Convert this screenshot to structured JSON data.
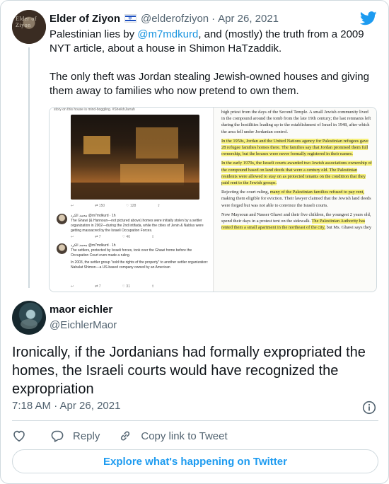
{
  "quoted_tweet": {
    "name": "Elder of Ziyon",
    "flag_icon": "israel-flag-icon",
    "handle": "@elderofziyon",
    "separator": "·",
    "date": "Apr 26, 2021",
    "avatar_text": "Elder of Ziyon",
    "text_prefix": "Palestinian lies by ",
    "mention": "@m7mdkurd",
    "text_suffix": ",  and (mostly)  the truth from a 2009 NYT article, about a house in Shimon HaTzaddik.",
    "paragraph2": "The only theft was Jordan stealing Jewish-owned houses and giving them away to families who now pretend to own them."
  },
  "media": {
    "left_top_caption": "story on this house is mind-boggling. #SheikhJarrah",
    "photo_actions": [
      "↩",
      "⇄ 150",
      "♡ 128",
      "⇪"
    ],
    "embedded_tweets": [
      {
        "header": "محمد الكرد @m7mdkurd · 1h",
        "body": "The Ghawi (& Hannoun—not pictured above) homes were initially stolen by a settler organization in 2002—during the 2nd intifada, while the cities of Jenin & Nablus were getting massacred by the Israeli Occupation Forces.",
        "actions": [
          "↩",
          "⇄ 7",
          "♡ 46",
          "⇪"
        ]
      },
      {
        "header": "محمد الكرد @m7mdkurd · 1h",
        "body": "The settlers, protected by Israeli forces, took over the Ghawi home before the Occupation Court even made a ruling.",
        "body2": "In 2003, the settler group \"sold the rights of the property\" to another settler organization: Nahalat Shimon—a US-based company owned by an American",
        "actions": [
          "↩",
          "⇄ 7",
          "♡ 31",
          "⇪"
        ]
      }
    ],
    "article_paragraphs": [
      {
        "text": "high priest from the days of the Second Temple. A small Jewish community lived in the compound around the tomb from the late 19th century; the last remnants left during the hostilities leading up to the establishment of Israel in 1948, after which the area fell under Jordanian control.",
        "hl": ""
      },
      {
        "text": "",
        "hl": "In the 1950s, Jordan and the United Nations agency for Palestinian refugees gave 28 refugee families homes there. The families say that Jordan promised them full ownership, but the houses were never formally registered in their names."
      },
      {
        "text": "",
        "hl": "In the early 1970s, the Israeli courts awarded two Jewish associations ownership of the compound based on land deeds that were a century old. The Palestinian residents were allowed to stay on as protected tenants on the condition that they paid rent to the Jewish groups."
      },
      {
        "text": "Rejecting the court ruling, ",
        "hl": "many of the Palestinian families refused to pay rent,",
        "text2": " making them eligible for eviction. Their lawyer claimed that the Jewish land deeds were forged but was not able to convince the Israeli courts."
      },
      {
        "text": "Now Maysoun and Nasser Ghawi and their five children, the youngest 2 years old, spend their days in a protest tent on the sidewalk. ",
        "hl": "The Palestinian Authority has rented them a small apartment in the northeast of the city,",
        "text2": " but Ms. Ghawi says they"
      }
    ]
  },
  "reply_tweet": {
    "name": "maor eichler",
    "handle": "@EichlerMaor",
    "text": "Ironically, if the Jordanians had formally expropriated the homes, the Israeli courts would have recognized the expropriation",
    "time": "7:18 AM · Apr 26, 2021"
  },
  "actions": {
    "like_icon": "heart-icon",
    "reply_label": "Reply",
    "copy_label": "Copy link to Tweet"
  },
  "explore_label": "Explore what's happening on Twitter",
  "colors": {
    "twitter_blue": "#1d9bf0",
    "mention_blue": "#1b95e0",
    "secondary_text": "#536471",
    "border": "#cfd9de",
    "highlight": "#f6f07a"
  }
}
